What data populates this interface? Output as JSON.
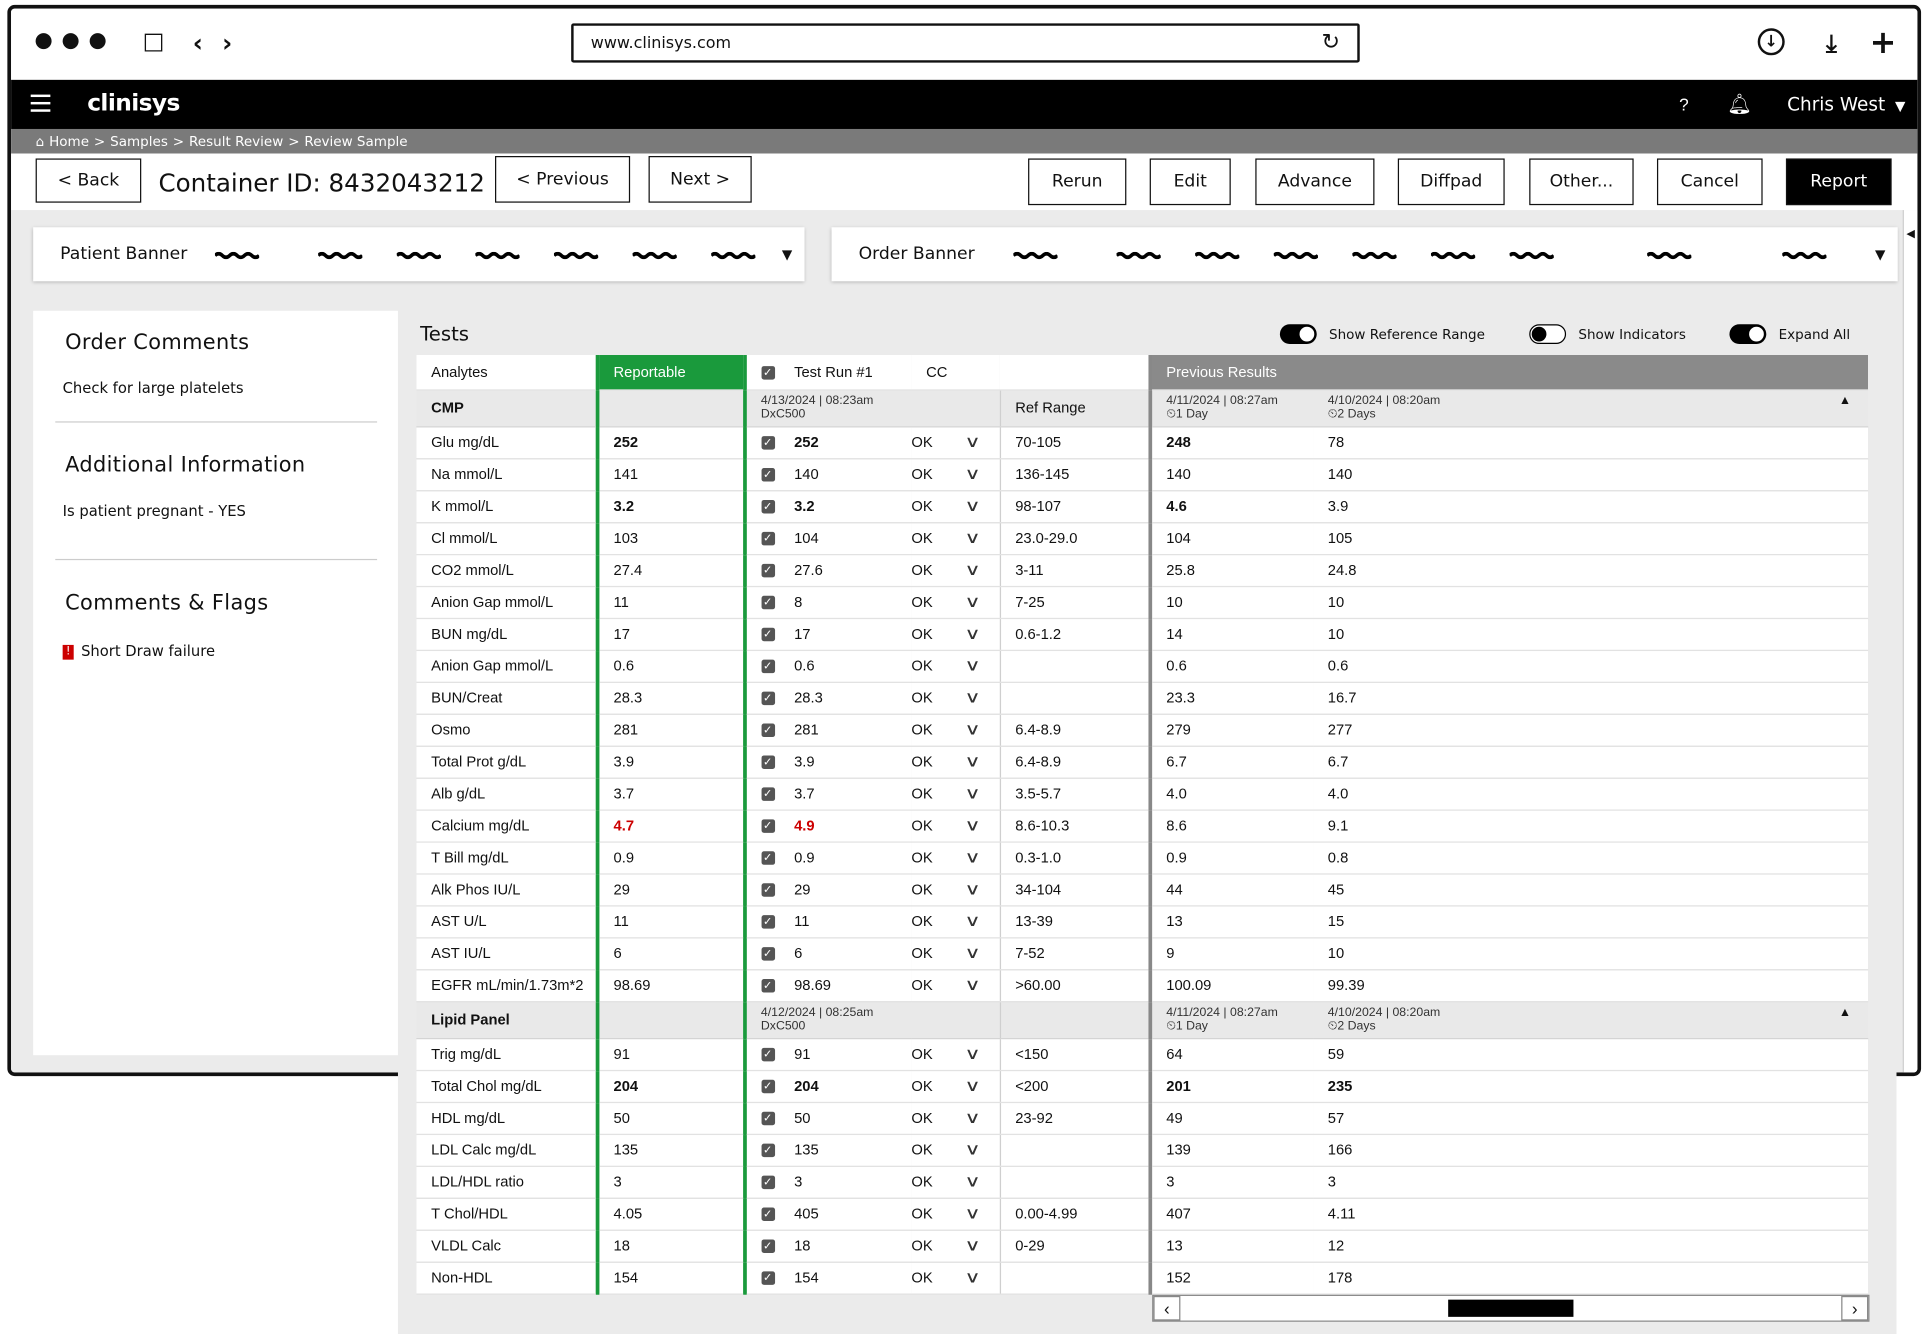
{
  "browser": {
    "url": "www.clinisys.com"
  },
  "app": {
    "logo": "clinisys",
    "help": "?",
    "user": "Chris West"
  },
  "breadcrumb": [
    "Home",
    ">",
    "Samples",
    ">",
    "Result Review",
    ">",
    "Review Sample"
  ],
  "toolbar": {
    "back": "< Back",
    "container_id": "Container ID: 8432043212",
    "previous": "< Previous",
    "next": "Next >",
    "rerun": "Rerun",
    "edit": "Edit",
    "advance": "Advance",
    "diffpad": "Diffpad",
    "other": "Other...",
    "cancel": "Cancel",
    "report": "Report"
  },
  "banners": {
    "patient": "Patient Banner",
    "order": "Order Banner"
  },
  "side": {
    "order_comments_title": "Order Comments",
    "order_comments_text": "Check for large platelets",
    "additional_title": "Additional Information",
    "additional_text": "Is patient pregnant - YES",
    "flags_title": "Comments & Flags",
    "flag_text": "Short Draw failure",
    "flag_icon": "!"
  },
  "tests": {
    "title": "Tests",
    "toggles": [
      {
        "label": "Show Reference Range",
        "on": true
      },
      {
        "label": "Show Indicators",
        "on": false
      },
      {
        "label": "Expand All",
        "on": true
      }
    ],
    "headers": {
      "analytes": "Analytes",
      "reportable": "Reportable",
      "test_run": "Test Run #1",
      "cc": "CC",
      "previous": "Previous Results",
      "ref_range": "Ref Range"
    },
    "sections": [
      {
        "name": "CMP",
        "run_meta": "4/13/2024 | 08:23am",
        "instrument": "DxC500",
        "prev1_date": "4/11/2024 | 08:27am",
        "prev1_age": "1 Day",
        "prev2_date": "4/10/2024 | 08:20am",
        "prev2_age": "2 Days",
        "rows": [
          {
            "analyte": "Glu  mg/dL",
            "rep": "252",
            "run": "252",
            "cc": "OK",
            "ref": "70-105",
            "p1": "248",
            "p2": "78",
            "bold": true
          },
          {
            "analyte": "Na  mmol/L",
            "rep": "141",
            "run": "140",
            "cc": "OK",
            "ref": "136-145",
            "p1": "140",
            "p2": "140"
          },
          {
            "analyte": "K  mmol/L",
            "rep": "3.2",
            "run": "3.2",
            "cc": "OK",
            "ref": "98-107",
            "p1": "4.6",
            "p2": "3.9",
            "bold": true
          },
          {
            "analyte": "Cl  mmol/L",
            "rep": "103",
            "run": "104",
            "cc": "OK",
            "ref": "23.0-29.0",
            "p1": "104",
            "p2": "105"
          },
          {
            "analyte": "CO2  mmol/L",
            "rep": "27.4",
            "run": "27.6",
            "cc": "OK",
            "ref": "3-11",
            "p1": "25.8",
            "p2": "24.8"
          },
          {
            "analyte": "Anion Gap  mmol/L",
            "rep": "11",
            "run": "8",
            "cc": "OK",
            "ref": "7-25",
            "p1": "10",
            "p2": "10"
          },
          {
            "analyte": "BUN  mg/dL",
            "rep": "17",
            "run": "17",
            "cc": "OK",
            "ref": "0.6-1.2",
            "p1": "14",
            "p2": "10"
          },
          {
            "analyte": "Anion Gap  mmol/L",
            "rep": "0.6",
            "run": "0.6",
            "cc": "OK",
            "ref": "",
            "p1": "0.6",
            "p2": "0.6"
          },
          {
            "analyte": "BUN/Creat",
            "rep": "28.3",
            "run": "28.3",
            "cc": "OK",
            "ref": "",
            "p1": "23.3",
            "p2": "16.7"
          },
          {
            "analyte": "Osmo",
            "rep": "281",
            "run": "281",
            "cc": "OK",
            "ref": "6.4-8.9",
            "p1": "279",
            "p2": "277"
          },
          {
            "analyte": "Total Prot  g/dL",
            "rep": "3.9",
            "run": "3.9",
            "cc": "OK",
            "ref": "6.4-8.9",
            "p1": "6.7",
            "p2": "6.7"
          },
          {
            "analyte": "Alb  g/dL",
            "rep": "3.7",
            "run": "3.7",
            "cc": "OK",
            "ref": "3.5-5.7",
            "p1": "4.0",
            "p2": "4.0"
          },
          {
            "analyte": "Calcium  mg/dL",
            "rep": "4.7",
            "run": "4.9",
            "cc": "OK",
            "ref": "8.6-10.3",
            "p1": "8.6",
            "p2": "9.1",
            "red": true
          },
          {
            "analyte": "T Bill  mg/dL",
            "rep": "0.9",
            "run": "0.9",
            "cc": "OK",
            "ref": "0.3-1.0",
            "p1": "0.9",
            "p2": "0.8"
          },
          {
            "analyte": "Alk Phos  IU/L",
            "rep": "29",
            "run": "29",
            "cc": "OK",
            "ref": "34-104",
            "p1": "44",
            "p2": "45"
          },
          {
            "analyte": "AST  U/L",
            "rep": "11",
            "run": "11",
            "cc": "OK",
            "ref": "13-39",
            "p1": "13",
            "p2": "15"
          },
          {
            "analyte": "AST  IU/L",
            "rep": "6",
            "run": "6",
            "cc": "OK",
            "ref": "7-52",
            "p1": "9",
            "p2": "10"
          },
          {
            "analyte": "EGFR  mL/min/1.73m*2",
            "rep": "98.69",
            "run": "98.69",
            "cc": "OK",
            "ref": ">60.00",
            "p1": "100.09",
            "p2": "99.39"
          }
        ]
      },
      {
        "name": "Lipid Panel",
        "run_meta": "4/12/2024 | 08:25am",
        "instrument": "DxC500",
        "prev1_date": "4/11/2024 | 08:27am",
        "prev1_age": "1 Day",
        "prev2_date": "4/10/2024 | 08:20am",
        "prev2_age": "2 Days",
        "rows": [
          {
            "analyte": "Trig  mg/dL",
            "rep": "91",
            "run": "91",
            "cc": "OK",
            "ref": "<150",
            "p1": "64",
            "p2": "59"
          },
          {
            "analyte": "Total Chol  mg/dL",
            "rep": "204",
            "run": "204",
            "cc": "OK",
            "ref": "<200",
            "p1": "201",
            "p2": "235",
            "bold": true
          },
          {
            "analyte": "HDL  mg/dL",
            "rep": "50",
            "run": "50",
            "cc": "OK",
            "ref": "23-92",
            "p1": "49",
            "p2": "57"
          },
          {
            "analyte": "LDL Calc  mg/dL",
            "rep": "135",
            "run": "135",
            "cc": "OK",
            "ref": "",
            "p1": "139",
            "p2": "166"
          },
          {
            "analyte": "LDL/HDL ratio",
            "rep": "3",
            "run": "3",
            "cc": "OK",
            "ref": "",
            "p1": "3",
            "p2": "3"
          },
          {
            "analyte": "T Chol/HDL",
            "rep": "4.05",
            "run": "405",
            "cc": "OK",
            "ref": "0.00-4.99",
            "p1": "407",
            "p2": "4.11"
          },
          {
            "analyte": "VLDL Calc",
            "rep": "18",
            "run": "18",
            "cc": "OK",
            "ref": "0-29",
            "p1": "13",
            "p2": "12"
          },
          {
            "analyte": "Non-HDL",
            "rep": "154",
            "run": "154",
            "cc": "OK",
            "ref": "",
            "p1": "152",
            "p2": "178"
          }
        ]
      }
    ]
  }
}
